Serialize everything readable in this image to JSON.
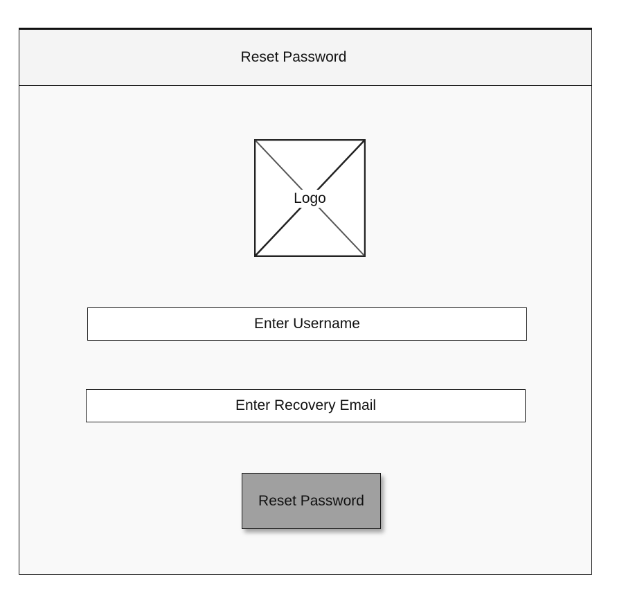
{
  "header": {
    "title": "Reset Password"
  },
  "logo": {
    "label": "Logo"
  },
  "form": {
    "username_placeholder": "Enter Username",
    "email_placeholder": "Enter Recovery Email",
    "submit_label": "Reset Password"
  },
  "colors": {
    "button_fill": "#a0a0a0",
    "frame_background": "#f9f9f9",
    "border": "#222222"
  }
}
